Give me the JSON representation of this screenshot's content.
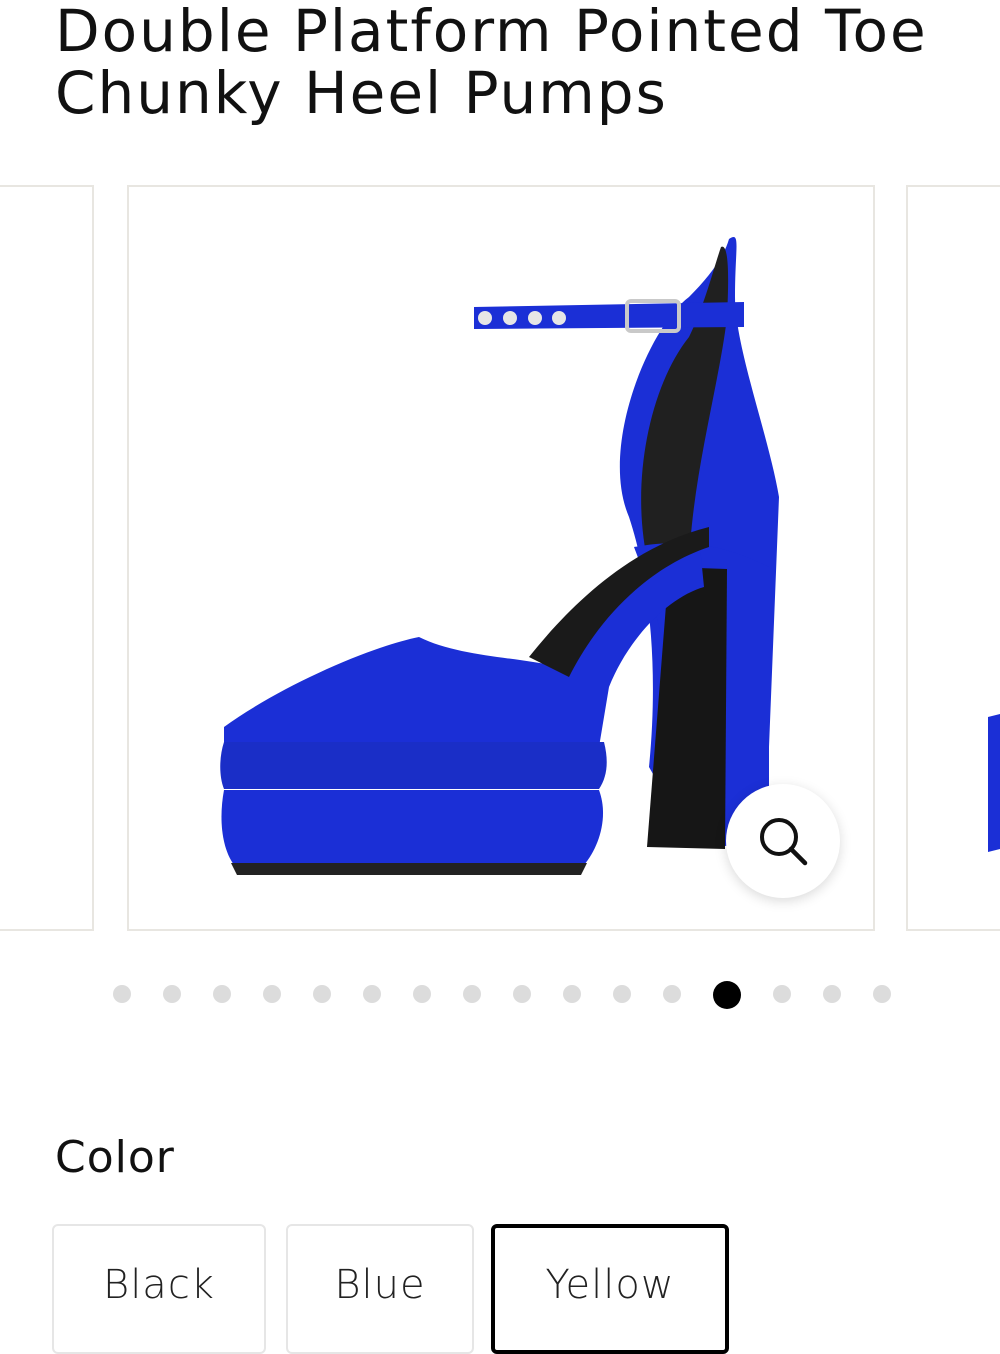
{
  "product": {
    "title": "Double Platform Pointed Toe Chunky Heel Pumps"
  },
  "gallery": {
    "slide_count": 16,
    "active_index": 12,
    "zoom_icon": "magnifier-icon",
    "shoe_color": "#1b2fd6"
  },
  "color": {
    "label": "Color",
    "options": [
      {
        "label": "Black"
      },
      {
        "label": "Blue"
      },
      {
        "label": "Yellow"
      }
    ],
    "selected": "Yellow"
  }
}
